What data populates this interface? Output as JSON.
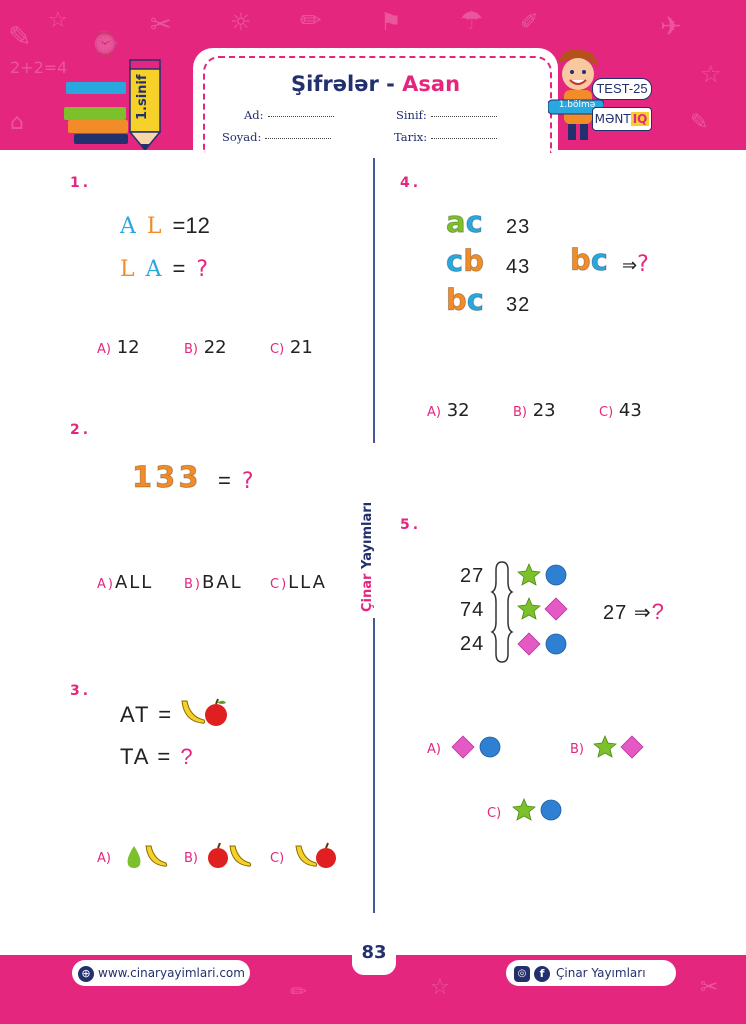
{
  "header": {
    "title_main": "Şifrələr -",
    "title_accent": "Asan",
    "grade": "1.sinif",
    "test_badge": "TEST-25",
    "section_badge": "1.bölmə",
    "subject_main": "MƏNT",
    "subject_accent": "IQ",
    "fields": {
      "name": "Ad:",
      "surname": "Soyad:",
      "class": "Sinif:",
      "date": "Tarix:"
    }
  },
  "divider_text": {
    "part1": "Çinar",
    "part2": "Yayımları"
  },
  "q1": {
    "num": "1.",
    "l1": "A",
    "l2": "L",
    "eq1": "=12",
    "l3": "L",
    "l4": "A",
    "eq2": "=",
    "q": "?",
    "options": [
      {
        "label": "A)",
        "value": "12"
      },
      {
        "label": "B)",
        "value": "22"
      },
      {
        "label": "C)",
        "value": "21"
      }
    ]
  },
  "q2": {
    "num": "2.",
    "code": "133",
    "eq": "=",
    "q": "?",
    "options": [
      {
        "label": "A)",
        "value": "ALL"
      },
      {
        "label": "B)",
        "value": "BAL"
      },
      {
        "label": "C)",
        "value": "LLA"
      }
    ]
  },
  "q3": {
    "num": "3.",
    "line1": "AT =",
    "line2": "TA =",
    "q": "?",
    "options": [
      {
        "label": "A)"
      },
      {
        "label": "B)"
      },
      {
        "label": "C)"
      }
    ]
  },
  "q4": {
    "num": "4.",
    "rows": [
      {
        "l1": "a",
        "l2": "c",
        "value": "23"
      },
      {
        "l1": "c",
        "l2": "b",
        "value": "43"
      },
      {
        "l1": "b",
        "l2": "c",
        "value": "32"
      }
    ],
    "ask_l1": "b",
    "ask_l2": "c",
    "arrow": "⇒",
    "q": "?",
    "options": [
      {
        "label": "A)",
        "value": "32"
      },
      {
        "label": "B)",
        "value": "23"
      },
      {
        "label": "C)",
        "value": "43"
      }
    ]
  },
  "q5": {
    "num": "5.",
    "rows": [
      "27",
      "74",
      "24"
    ],
    "ask": "27",
    "arrow": "⇒",
    "q": "?",
    "options": [
      {
        "label": "A)"
      },
      {
        "label": "B)"
      },
      {
        "label": "C)"
      }
    ]
  },
  "footer": {
    "website": "www.cinaryayimlari.com",
    "brand": "Çinar Yayımları",
    "page": "83"
  },
  "colors": {
    "magenta": "#e5267f",
    "navy": "#23306e",
    "green": "#7cc02b",
    "blue": "#29a8e0",
    "orange": "#f28c28",
    "diamond": "#e559c5",
    "circle": "#2f7fd3"
  }
}
